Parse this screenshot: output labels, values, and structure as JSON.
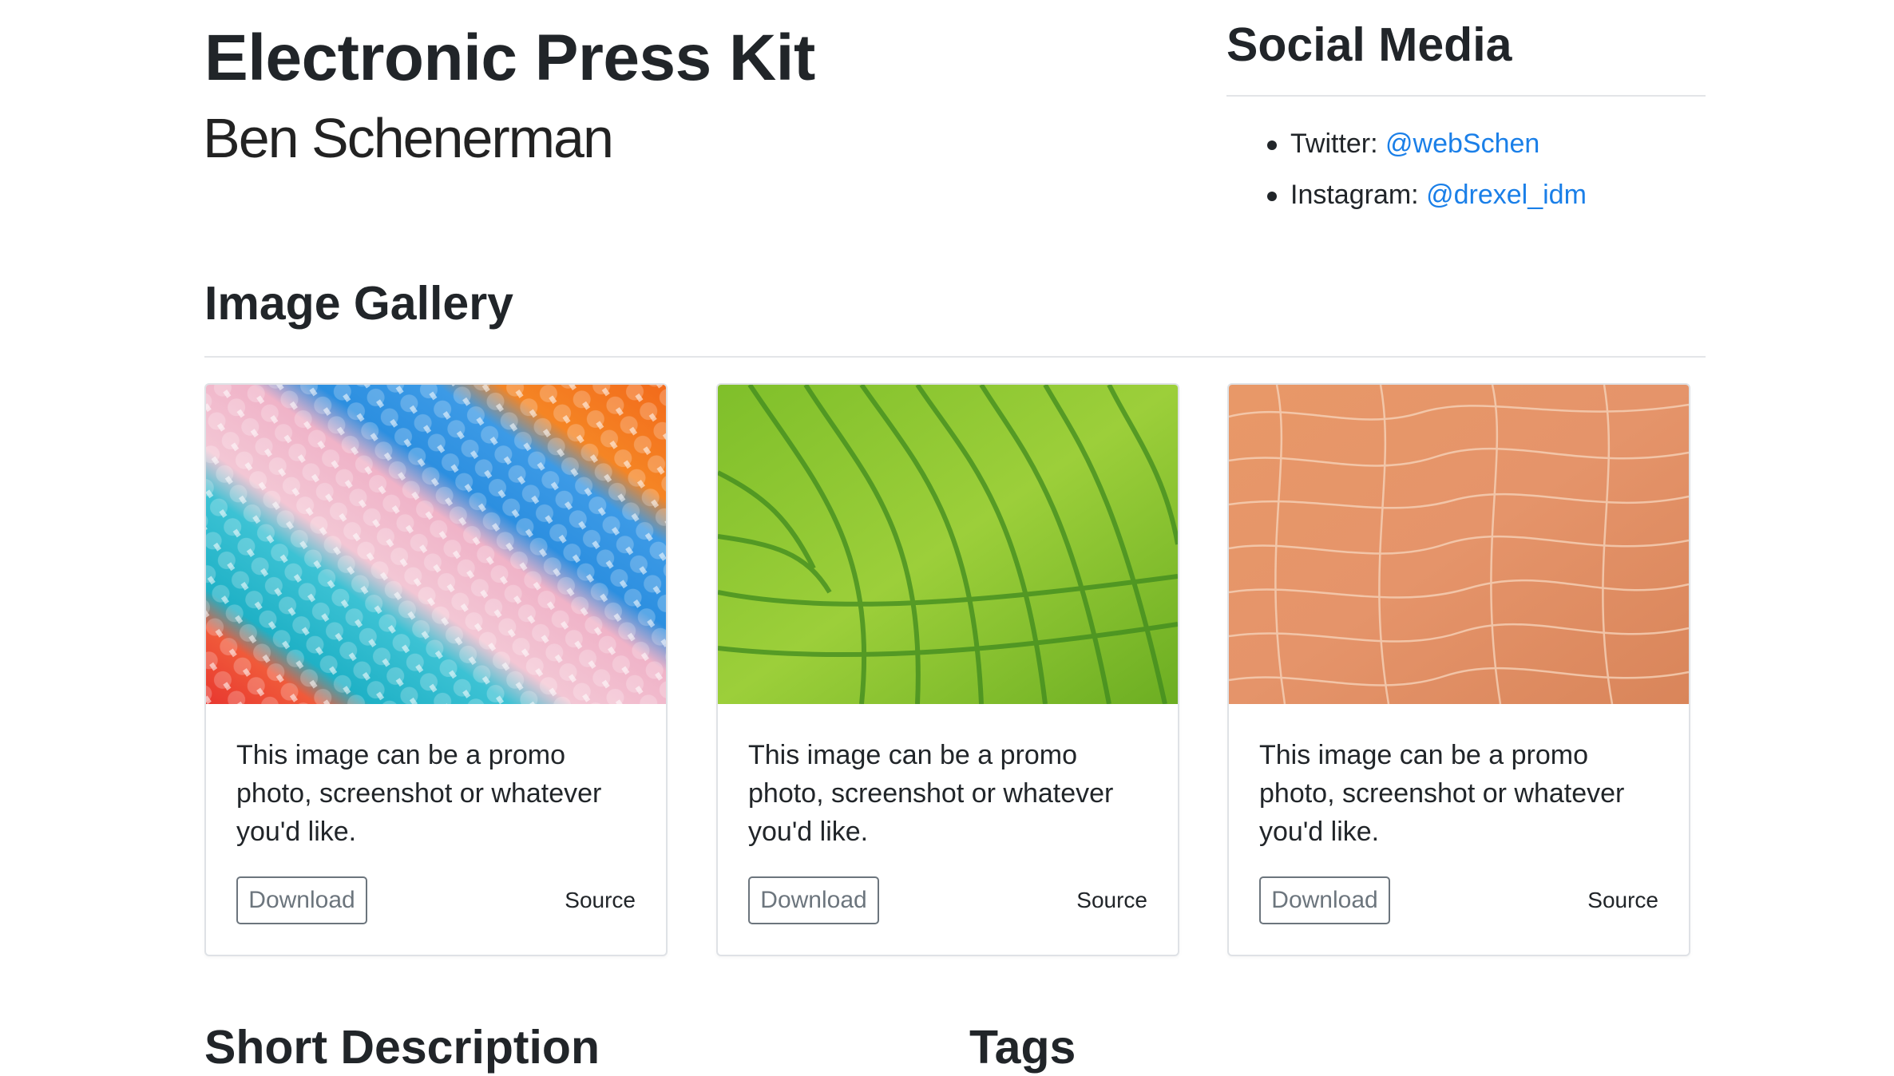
{
  "header": {
    "title": "Electronic Press Kit",
    "subtitle": "Ben Schenerman"
  },
  "social": {
    "title": "Social Media",
    "items": [
      {
        "label": "Twitter: ",
        "handle": "@webSchen"
      },
      {
        "label": "Instagram: ",
        "handle": "@drexel_idm"
      }
    ],
    "link_color": "#1a7fe8"
  },
  "gallery": {
    "title": "Image Gallery",
    "cards": [
      {
        "image": "colorful-lanterns-photo",
        "text": "This image can be a promo photo, screenshot or whatever you'd like.",
        "download_label": "Download",
        "source_label": "Source"
      },
      {
        "image": "green-rice-fields-aerial-photo",
        "text": "This image can be a promo photo, screenshot or whatever you'd like.",
        "download_label": "Download",
        "source_label": "Source"
      },
      {
        "image": "orange-sand-texture-photo",
        "text": "This image can be a promo photo, screenshot or whatever you'd like.",
        "download_label": "Download",
        "source_label": "Source"
      }
    ]
  },
  "sections": {
    "short_description": "Short Description",
    "tags": "Tags"
  }
}
